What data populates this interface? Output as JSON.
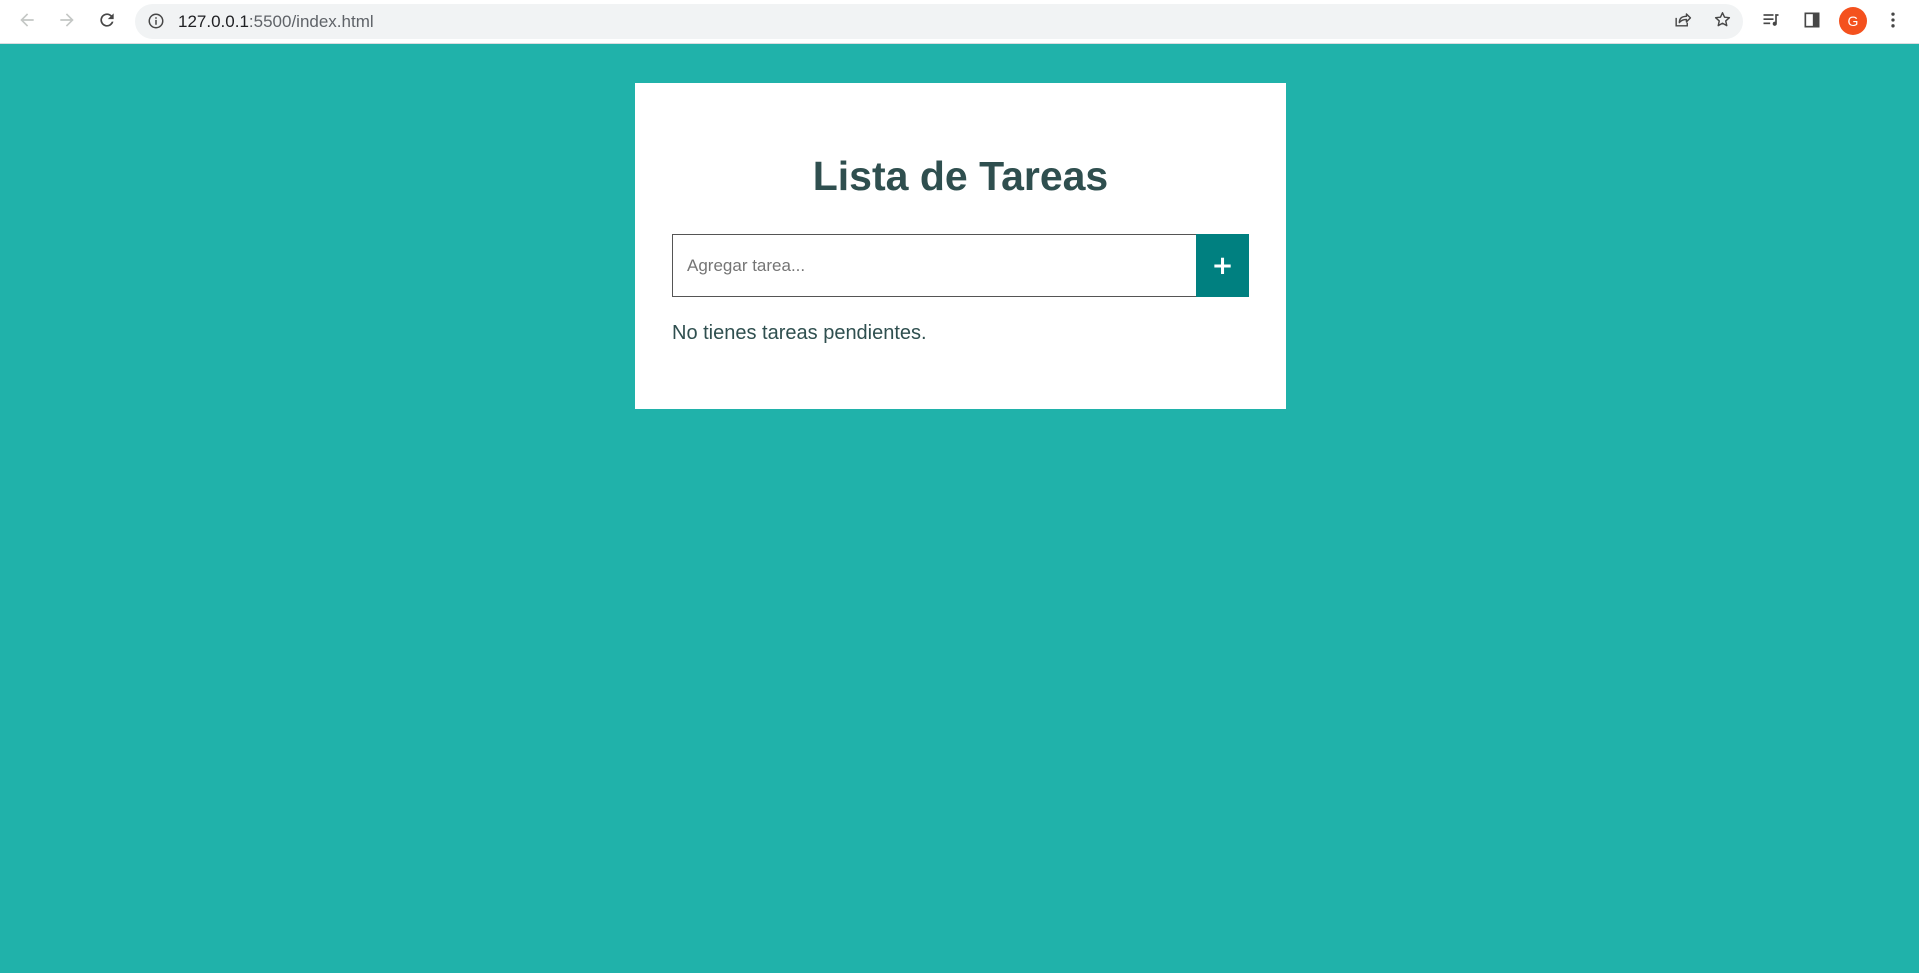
{
  "browser": {
    "url_host": "127.0.0.1",
    "url_path": ":5500/index.html",
    "profile_initial": "G",
    "profile_color": "#f4511e"
  },
  "icons": {
    "back": "arrow-left-icon",
    "forward": "arrow-right-icon",
    "reload": "reload-icon",
    "site_info": "info-icon",
    "share": "share-icon",
    "bookmark": "star-icon",
    "media": "media-queue-icon",
    "side_panel": "side-panel-icon",
    "menu": "kebab-menu-icon",
    "add": "plus-icon"
  },
  "app": {
    "title": "Lista de Tareas",
    "input_placeholder": "Agregar tarea...",
    "input_value": "",
    "add_button_label": "+",
    "empty_message": "No tienes tareas pendientes."
  },
  "colors": {
    "page_background": "#20b2aa",
    "card_background": "#ffffff",
    "accent": "#008080",
    "text": "#2f4f4f"
  }
}
